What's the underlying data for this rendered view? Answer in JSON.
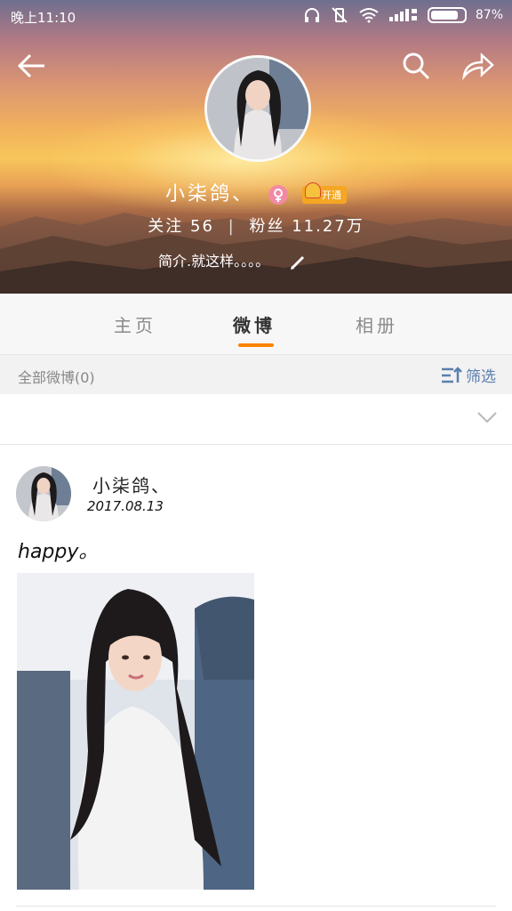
{
  "status_bar": {
    "time": "晚上11:10",
    "battery_percent": "87%"
  },
  "profile": {
    "name": "小柒鸽、",
    "vip_label": "开通",
    "following_label": "关注",
    "following_count": "56",
    "followers_label": "粉丝",
    "followers_count": "11.27万",
    "bio": "简介.就这样。。。。"
  },
  "tabs": [
    {
      "label": "主页"
    },
    {
      "label": "微博"
    },
    {
      "label": "相册"
    }
  ],
  "filter": {
    "label": "全部微博(0)",
    "button_label": "筛选"
  },
  "post": {
    "author": "小柒鸽、",
    "date": "2017.08.13",
    "text": "happy。"
  },
  "colors": {
    "accent": "#ff8200",
    "link": "#5b7fad"
  }
}
